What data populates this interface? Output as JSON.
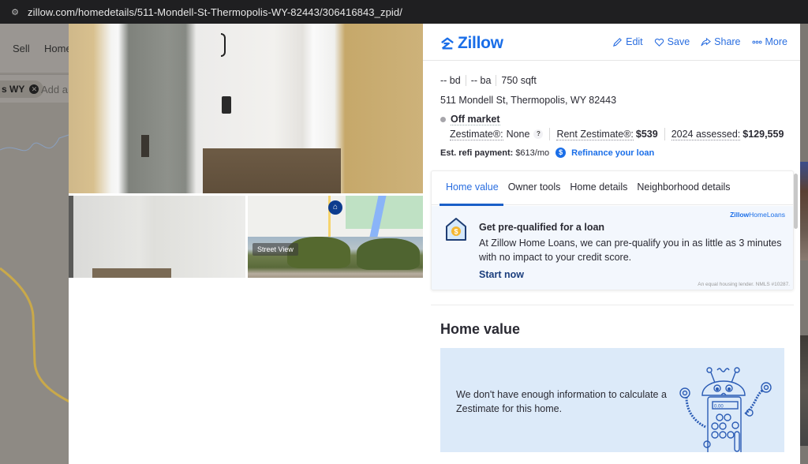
{
  "browser": {
    "url": "zillow.com/homedetails/511-Mondell-St-Thermopolis-WY-82443/306416843_zpid/",
    "site_settings_icon": "tune-icon"
  },
  "background_page": {
    "nav": [
      "Sell",
      "Home"
    ],
    "filter_chip": "s WY",
    "filter_input_placeholder": "Add a"
  },
  "photos": {
    "street_view_label": "Street View"
  },
  "header": {
    "logo": "Zillow",
    "actions": [
      {
        "label": "Edit",
        "icon": "pencil-icon"
      },
      {
        "label": "Save",
        "icon": "heart-icon"
      },
      {
        "label": "Share",
        "icon": "share-icon"
      },
      {
        "label": "More",
        "icon": "more-dots-icon"
      }
    ]
  },
  "facts": {
    "beds": "-- bd",
    "baths": "-- ba",
    "sqft": "750 sqft"
  },
  "address": "511 Mondell St, Thermopolis, WY 82443",
  "status": "Off market",
  "zestimate": {
    "label": "Zestimate®:",
    "value": "None",
    "help": "?",
    "rent_label": "Rent Zestimate®:",
    "rent_value": "$539",
    "assessed_label": "2024 assessed:",
    "assessed_value": "$129,559"
  },
  "refi": {
    "label": "Est. refi payment:",
    "value": "$613/mo",
    "link": "Refinance your loan"
  },
  "tabs": [
    {
      "label": "Home value",
      "active": true
    },
    {
      "label": "Owner tools",
      "active": false
    },
    {
      "label": "Home details",
      "active": false
    },
    {
      "label": "Neighborhood details",
      "active": false
    }
  ],
  "promo": {
    "brand_bold": "Zillow",
    "brand_rest": "HomeLoans",
    "title": "Get pre-qualified for a loan",
    "body": "At Zillow Home Loans, we can pre-qualify you in as little as 3 minutes with no impact to your credit score.",
    "cta": "Start now",
    "fine_print": "An equal housing lender. NMLS #10287."
  },
  "home_value": {
    "title": "Home value",
    "message": "We don't have enough information to calculate a Zestimate for this home.",
    "robot_display": "0.00"
  },
  "colors": {
    "brand_blue": "#1a6ee8",
    "cta_navy": "#1b3e7d",
    "promo_bg": "#f3f7fd",
    "info_bg": "#dceaf9"
  }
}
